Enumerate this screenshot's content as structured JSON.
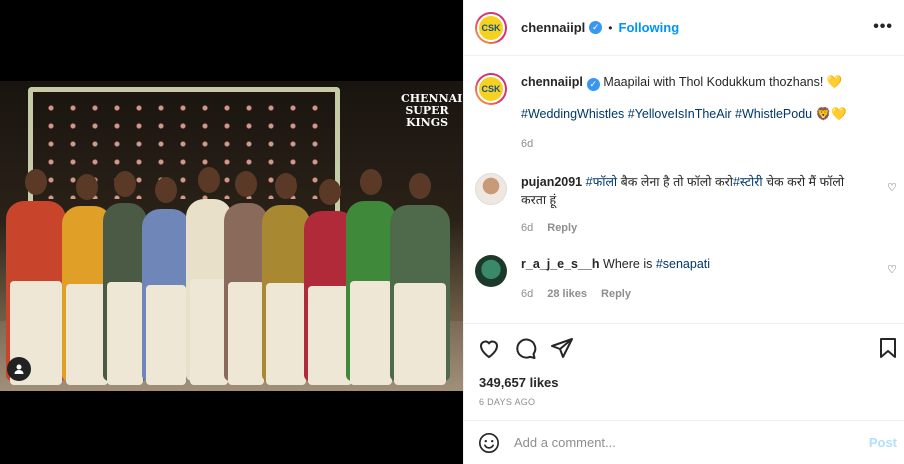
{
  "post": {
    "logo_text": "CHENNAI SUPER KINGS"
  },
  "header": {
    "username": "chennaiipl",
    "separator": "•",
    "follow_status": "Following",
    "more_label": "•••"
  },
  "caption": {
    "username": "chennaiipl",
    "text": "Maapilai with Thol Kodukkum thozhans! 💛",
    "hashtags": "#WeddingWhistles #YelloveIsInTheAir #WhistlePodu 🦁💛",
    "time": "6d"
  },
  "comments": [
    {
      "username": "pujan2091",
      "text_tag1": "#फॉलो",
      "text_mid": " बैक लेना है तो फॉलो करो",
      "text_tag2": "#स्टोरी",
      "text_end": " चेक करो मैं फॉलो करता हूं",
      "time": "6d",
      "reply_label": "Reply"
    },
    {
      "username": "r_a_j_e_s__h",
      "text": "Where is ",
      "tag": "#senapati",
      "time": "6d",
      "likes": "28 likes",
      "reply_label": "Reply"
    }
  ],
  "stats": {
    "likes": "349,657 likes",
    "posted": "6 DAYS AGO"
  },
  "add_comment": {
    "placeholder": "Add a comment...",
    "post_label": "Post"
  },
  "colors": {
    "link": "#0095f6",
    "hashtag": "#00376b",
    "muted": "#8e8e8e",
    "post_disabled": "#b2dffc"
  }
}
